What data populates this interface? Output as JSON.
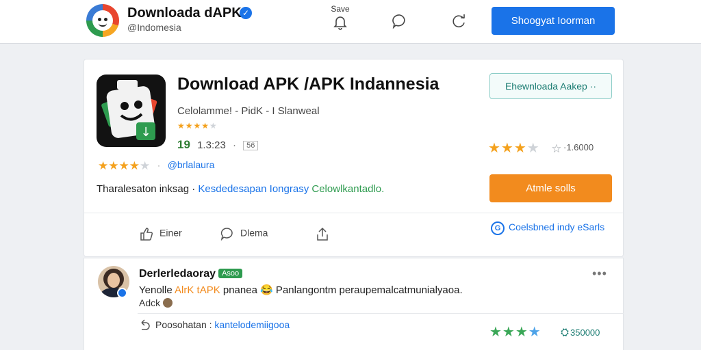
{
  "header": {
    "brand_name": "Downloada dAPK",
    "brand_handle": "@Indomesia",
    "save_label": "Save",
    "cta_label": "Shoogyat Ioorman"
  },
  "app": {
    "title": "Download APK /APK Indannesia",
    "subtitle": "Celolamme! - PidK - I Slanweal",
    "version": "19",
    "date": "1.3:23",
    "tag": "56",
    "rating_link": "@brlalaura",
    "rating_fraction": 0.8,
    "description": {
      "part1": "Tharalesaton inksag · ",
      "part2": "Kesdedesapan Iongrasy",
      "part3": " Celowlkantadlo."
    },
    "outline_button": "Ehewnloada Aakep ··",
    "right_count": "·1.6000",
    "orange_button": "Atmle solls",
    "share_link": "Coelsbned indy eSarls"
  },
  "actions": {
    "like": "Einer",
    "comment": "Dlema"
  },
  "comment": {
    "name": "Derlerledaoray",
    "badge": "Asoo",
    "text_part1": "Yenolle ",
    "text_highlight": "AlrK tAPK",
    "text_part2": " pnanea 😂 Panlangontm peraupemalcatmunialyaoa.",
    "line2": "Adck",
    "reply_label": "Poosohatan : ",
    "reply_link": "kantelodemiigooa",
    "bottom_count": "350000"
  },
  "colors": {
    "primary": "#1a73e8",
    "orange": "#f28b1e",
    "green": "#2e9b4f",
    "star": "#f4a11d"
  }
}
